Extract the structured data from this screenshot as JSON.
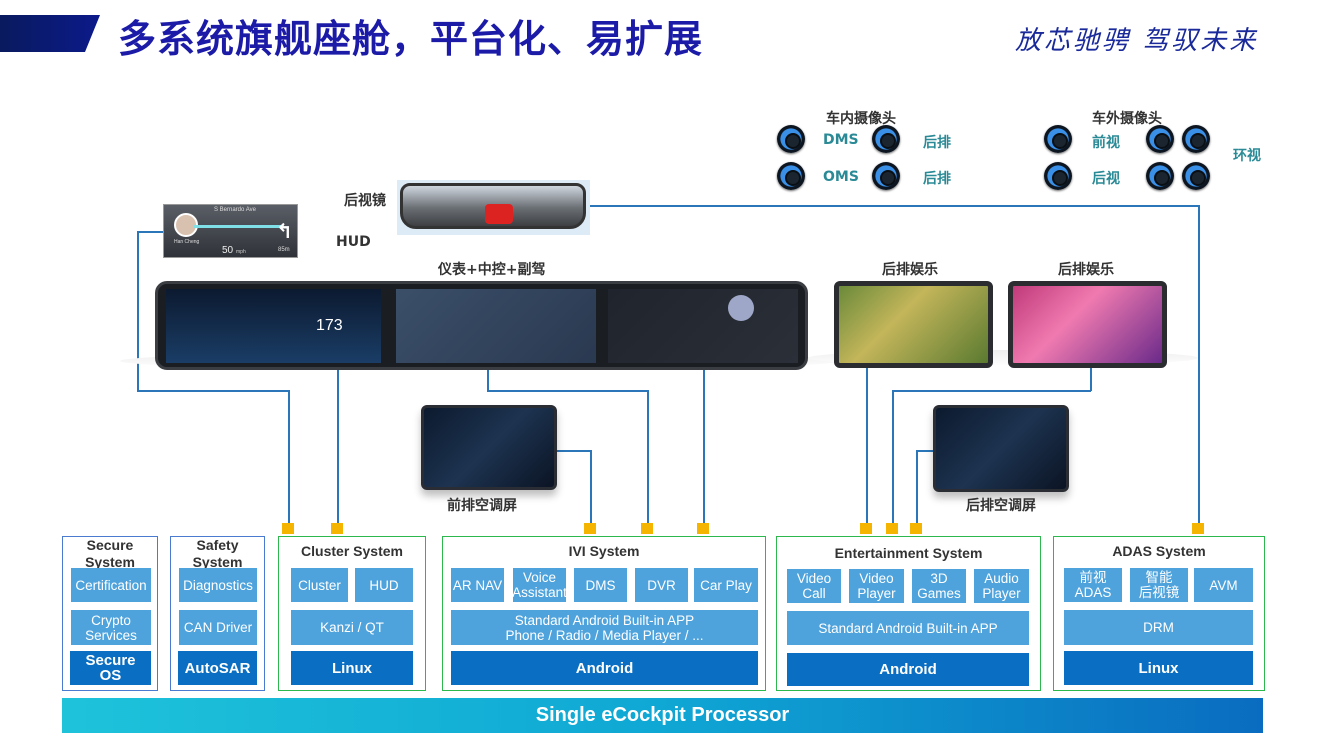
{
  "header": {
    "title": "多系统旗舰座舱，平台化、易扩展",
    "slogan": "放芯驰骋  驾驭未来"
  },
  "cameras": {
    "interior": {
      "title": "车内摄像头",
      "dms": "DMS",
      "oms": "OMS",
      "rear1": "后排",
      "rear2": "后排"
    },
    "exterior": {
      "title": "车外摄像头",
      "front": "前视",
      "rear": "后视",
      "surround": "环视"
    }
  },
  "displays": {
    "mirror": "后视镜",
    "hud": "HUD",
    "main": "仪表+中控+副驾",
    "rear_ent_1": "后排娱乐",
    "rear_ent_2": "后排娱乐",
    "front_ac": "前排空调屏",
    "rear_ac": "后排空调屏"
  },
  "hud_screen": {
    "street": "S Bernardo Ave",
    "caller": "Han Cheng",
    "speed": "50",
    "speed_unit": "mph",
    "distance": "85m"
  },
  "cluster_screen": {
    "speed": "173"
  },
  "systems": {
    "secure": {
      "title": "Secure System",
      "items": [
        "Certification",
        "Crypto\nServices"
      ],
      "os": "Secure\nOS"
    },
    "safety": {
      "title": "Safety System",
      "items": [
        "Diagnostics",
        "CAN Driver"
      ],
      "os": "AutoSAR"
    },
    "cluster": {
      "title": "Cluster System",
      "apps": [
        "Cluster",
        "HUD"
      ],
      "middleware": "Kanzi / QT",
      "os": "Linux"
    },
    "ivi": {
      "title": "IVI System",
      "apps": [
        "AR NAV",
        "Voice\nAssistant",
        "DMS",
        "DVR",
        "Car Play"
      ],
      "middleware": "Standard Android Built-in APP\nPhone / Radio / Media Player / ...",
      "os": "Android"
    },
    "entertainment": {
      "title": "Entertainment System",
      "apps": [
        "Video\nCall",
        "Video\nPlayer",
        "3D\nGames",
        "Audio\nPlayer"
      ],
      "middleware": "Standard Android Built-in APP",
      "os": "Android"
    },
    "adas": {
      "title": "ADAS System",
      "apps": [
        "前视\nADAS",
        "智能\n后视镜",
        "AVM"
      ],
      "middleware": "DRM",
      "os": "Linux"
    }
  },
  "processor": "Single eCockpit Processor",
  "colors": {
    "title": "#1b1ba8",
    "light_block": "#4fa3dc",
    "dark_block": "#0a6fc2",
    "system_border": "#2db84d",
    "connector": "#f5b400",
    "line": "#2a76b8"
  }
}
